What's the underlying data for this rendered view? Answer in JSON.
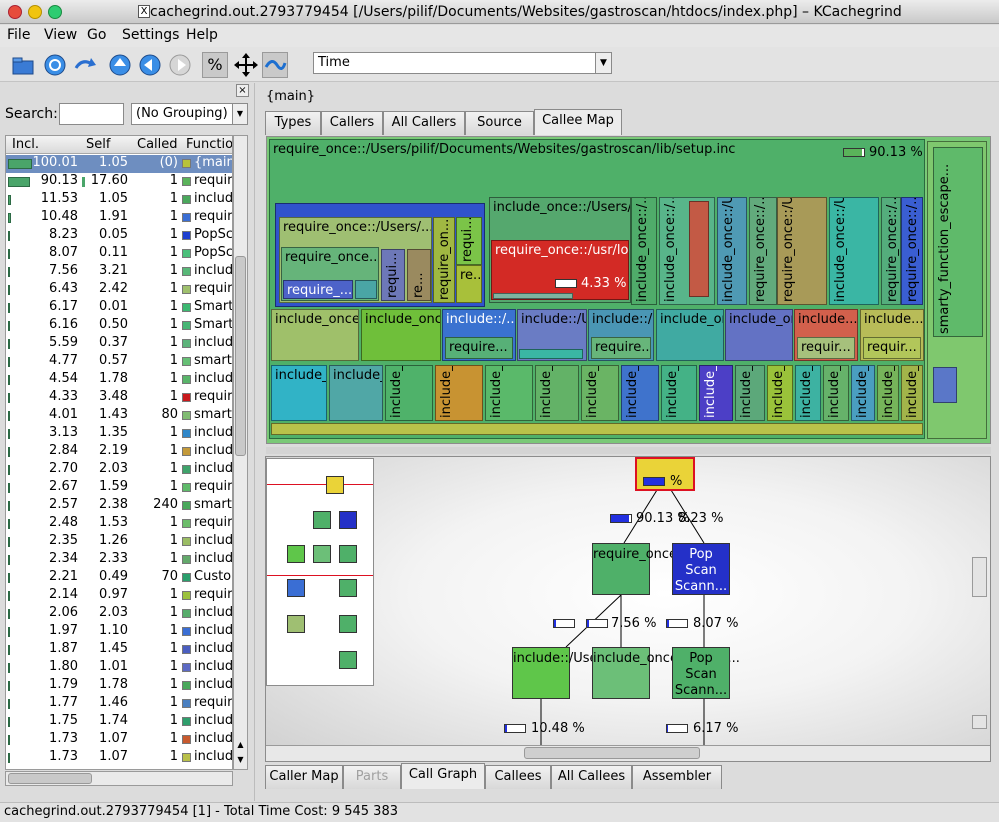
{
  "window": {
    "title": "cachegrind.out.2793779454 [/Users/pilif/Documents/Websites/gastroscan/htdocs/index.php] – KCachegrind",
    "app_icon": "X"
  },
  "menu": [
    "File",
    "View",
    "Go",
    "Settings",
    "Help"
  ],
  "toolbar": {
    "event_type": "Time",
    "icons": [
      "open-icon",
      "reload-icon",
      "redo-icon",
      "up-icon",
      "back-icon",
      "forward-icon",
      "percent-icon",
      "move-icon",
      "cycle-icon"
    ]
  },
  "left": {
    "search_label": "Search:",
    "search_value": "",
    "grouping": "(No Grouping)",
    "columns": [
      "Incl.",
      "Self",
      "Called",
      "Function"
    ],
    "rows": [
      {
        "incl": "100.01",
        "self": "1.05",
        "called": "(0)",
        "color": "#b7c23a",
        "name": "{main}"
      },
      {
        "incl": "90.13",
        "self": "17.60",
        "called": "1",
        "color": "#5ab35a",
        "name": "require_once"
      },
      {
        "incl": "11.53",
        "self": "1.05",
        "called": "1",
        "color": "#4aa85c",
        "name": "include_once"
      },
      {
        "incl": "10.48",
        "self": "1.91",
        "called": "1",
        "color": "#3a6ed4",
        "name": "require_once"
      },
      {
        "incl": "8.23",
        "self": "0.05",
        "called": "1",
        "color": "#1e3fd0",
        "name": "PopScan"
      },
      {
        "incl": "8.07",
        "self": "0.11",
        "called": "1",
        "color": "#4bbf7a",
        "name": "PopScan"
      },
      {
        "incl": "7.56",
        "self": "3.21",
        "called": "1",
        "color": "#58b878",
        "name": "include_once"
      },
      {
        "incl": "6.43",
        "self": "2.42",
        "called": "1",
        "color": "#9fc06d",
        "name": "require_once"
      },
      {
        "incl": "6.17",
        "self": "0.01",
        "called": "1",
        "color": "#3cb871",
        "name": "Smarty"
      },
      {
        "incl": "6.16",
        "self": "0.50",
        "called": "1",
        "color": "#47b675",
        "name": "Smarty"
      },
      {
        "incl": "5.59",
        "self": "0.37",
        "called": "1",
        "color": "#5cb37a",
        "name": "include_once"
      },
      {
        "incl": "4.77",
        "self": "0.57",
        "called": "1",
        "color": "#66c075",
        "name": "smarty"
      },
      {
        "incl": "4.54",
        "self": "1.78",
        "called": "1",
        "color": "#59b56a",
        "name": "include_once"
      },
      {
        "incl": "4.33",
        "self": "3.48",
        "called": "1",
        "color": "#c8191c",
        "name": "require_once"
      },
      {
        "incl": "4.01",
        "self": "1.43",
        "called": "80",
        "color": "#80bb72",
        "name": "smarty"
      },
      {
        "incl": "3.13",
        "self": "1.35",
        "called": "1",
        "color": "#2f87c9",
        "name": "include_once"
      },
      {
        "incl": "2.84",
        "self": "2.19",
        "called": "1",
        "color": "#c49a3a",
        "name": "include_once"
      },
      {
        "incl": "2.70",
        "self": "2.03",
        "called": "1",
        "color": "#3fa36b",
        "name": "include_once"
      },
      {
        "incl": "2.67",
        "self": "1.59",
        "called": "1",
        "color": "#5fba6a",
        "name": "require_once"
      },
      {
        "incl": "2.57",
        "self": "2.38",
        "called": "240",
        "color": "#4aa85c",
        "name": "smarty"
      },
      {
        "incl": "2.48",
        "self": "1.53",
        "called": "1",
        "color": "#6cbd6a",
        "name": "require_once"
      },
      {
        "incl": "2.35",
        "self": "1.26",
        "called": "1",
        "color": "#9bbd64",
        "name": "include_once"
      },
      {
        "incl": "2.34",
        "self": "2.33",
        "called": "1",
        "color": "#63a96b",
        "name": "include_once"
      },
      {
        "incl": "2.21",
        "self": "0.49",
        "called": "70",
        "color": "#2a9e6c",
        "name": "Custom"
      },
      {
        "incl": "2.14",
        "self": "0.97",
        "called": "1",
        "color": "#9cc23e",
        "name": "require_once"
      },
      {
        "incl": "2.06",
        "self": "2.03",
        "called": "1",
        "color": "#57ad6b",
        "name": "include_once"
      },
      {
        "incl": "1.97",
        "self": "1.10",
        "called": "1",
        "color": "#3a6ed4",
        "name": "include_once"
      },
      {
        "incl": "1.87",
        "self": "1.45",
        "called": "1",
        "color": "#4a5ec0",
        "name": "include_once"
      },
      {
        "incl": "1.80",
        "self": "1.01",
        "called": "1",
        "color": "#5d6ac4",
        "name": "include_once"
      },
      {
        "incl": "1.79",
        "self": "1.78",
        "called": "1",
        "color": "#4aa85c",
        "name": "include_once"
      },
      {
        "incl": "1.77",
        "self": "1.46",
        "called": "1",
        "color": "#4a7fc0",
        "name": "require_once"
      },
      {
        "incl": "1.75",
        "self": "1.74",
        "called": "1",
        "color": "#2f9e6c",
        "name": "include_once"
      },
      {
        "incl": "1.73",
        "self": "1.07",
        "called": "1",
        "color": "#c85a2e",
        "name": "include_once"
      },
      {
        "incl": "1.73",
        "self": "1.07",
        "called": "1",
        "color": "#b9c04a",
        "name": "include_once"
      }
    ]
  },
  "right": {
    "context": "{main}",
    "top_tabs": [
      "Types",
      "Callers",
      "All Callers",
      "Source",
      "Callee Map"
    ],
    "active_top_tab": "Callee Map",
    "bottom_tabs": [
      "Caller Map",
      "Parts",
      "Call Graph",
      "Callees",
      "All Callees",
      "Assembler"
    ],
    "active_bottom_tab": "Call Graph",
    "map": {
      "main_label": "require_once::/Users/pilif/Documents/Websites/gastroscan/lib/setup.inc",
      "main_pct": "90.13 %",
      "date_label": "require_once::/usr/local/lib/php/Date.php",
      "date_pct": "4.33 %",
      "blk_a": "include_once::/Users/pilif/Documents/We...",
      "blk_b": "require_once::/Users/...",
      "blk_c": "require_once...",
      "blk_d": "require_...",
      "right_strip": "smarty_function_escape...",
      "v1": "include_once::/...",
      "v2": "include_once::/...",
      "v3": "include_once::/Us...",
      "v4": "require_once::/Users/pilif/Doc...",
      "v5": "include_once::/Users/pilif/Doc...",
      "v6": "require_once::/...",
      "v7": "require_once::/...",
      "v8": "re...",
      "v9": "requi...",
      "v10": "require_on...",
      "r2a": "include_once::/Users/pilif/Documents...",
      "r2b": "include_once::/Users/pili...",
      "r2c": "include::/...",
      "r2c2": "require...",
      "r2d": "include::/Users/pi...",
      "r2e": "include::/...",
      "r2e2": "require...",
      "r2f": "include_once::/Users/p...",
      "r2g": "include_once::/Users/p...",
      "r2h": "include...",
      "r2h2": "requir...",
      "r2i": "include...",
      "r2i2": "requir...",
      "r3a": "include_once::/Users/...",
      "r3b": "include_once::/...",
      "r3c": "include_"
    },
    "graph": {
      "root_pct": "%",
      "e1_pct": "90.13 %",
      "e2_pct": "8.23 %",
      "n1": "require_once::/Use...",
      "n2": "Pop Scan Scann...",
      "e3_pct": "10.48 %",
      "e4_pct": "7.56 %",
      "e5_pct": "8.07 %",
      "n3": "include::/Users/pilif/...",
      "n4": "include_once::/Users...",
      "n5": "Pop Scan Scann...",
      "e6_pct": "10.48 %",
      "e7_pct": "6.17 %"
    }
  },
  "status": "cachegrind.out.2793779454 [1] - Total Time Cost:  9 545 383"
}
